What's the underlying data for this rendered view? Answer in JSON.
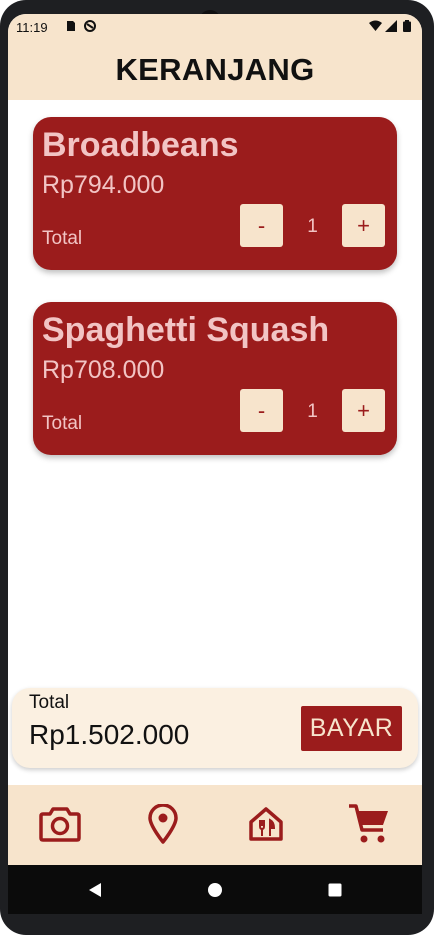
{
  "status_bar": {
    "time": "11:19",
    "icons": [
      "sd-card-icon",
      "do-not-disturb-icon",
      "wifi-icon",
      "signal-icon",
      "battery-icon"
    ]
  },
  "app_bar": {
    "title": "KERANJANG"
  },
  "cart_items": [
    {
      "name": "Broadbeans",
      "price": "Rp794.000",
      "total_label": "Total",
      "minus": "-",
      "quantity": "1",
      "plus": "+"
    },
    {
      "name": "Spaghetti Squash",
      "price": "Rp708.000",
      "total_label": "Total",
      "minus": "-",
      "quantity": "1",
      "plus": "+"
    }
  ],
  "footer": {
    "total_label": "Total",
    "total_value": "Rp1.502.000",
    "pay_button": "BAYAR"
  },
  "bottom_nav": {
    "items": [
      "camera-icon",
      "location-pin-icon",
      "restaurant-icon",
      "cart-icon"
    ]
  },
  "system_nav": {
    "items": [
      "back-icon",
      "home-icon",
      "recents-icon"
    ]
  },
  "colors": {
    "primary": "#9b1c1c",
    "cream": "#f7e4cc",
    "card_text": "#f2c4c4",
    "footer_bg": "#fbf0e1"
  }
}
